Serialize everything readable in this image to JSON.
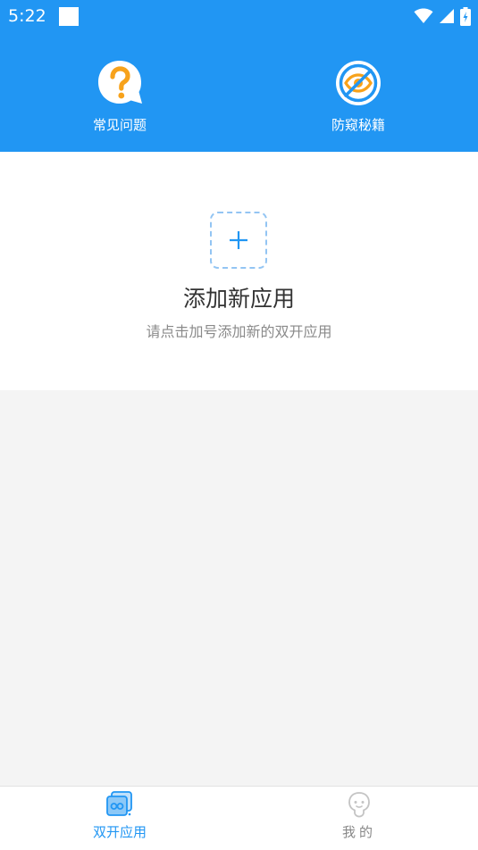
{
  "status_bar": {
    "time": "5:22",
    "icons": [
      "notification-square-icon",
      "wifi-icon",
      "cell-signal-icon",
      "battery-charging-icon"
    ]
  },
  "header": {
    "items": [
      {
        "label": "常见问题",
        "icon": "question-bubble-icon"
      },
      {
        "label": "防窥秘籍",
        "icon": "eye-off-icon"
      }
    ]
  },
  "add_app": {
    "icon": "plus-icon",
    "title": "添加新应用",
    "subtitle": "请点击加号添加新的双开应用"
  },
  "bottom_nav": {
    "items": [
      {
        "label": "双开应用",
        "icon": "dual-app-icon",
        "active": true
      },
      {
        "label": "我的",
        "icon": "user-face-icon",
        "active": false
      }
    ]
  },
  "colors": {
    "primary": "#2196f3",
    "accent_orange": "#f7a21b",
    "background": "#f4f4f4",
    "card": "#ffffff",
    "title_text": "#333333",
    "subtitle_text": "#8a8a8a",
    "inactive_nav": "#888888"
  }
}
